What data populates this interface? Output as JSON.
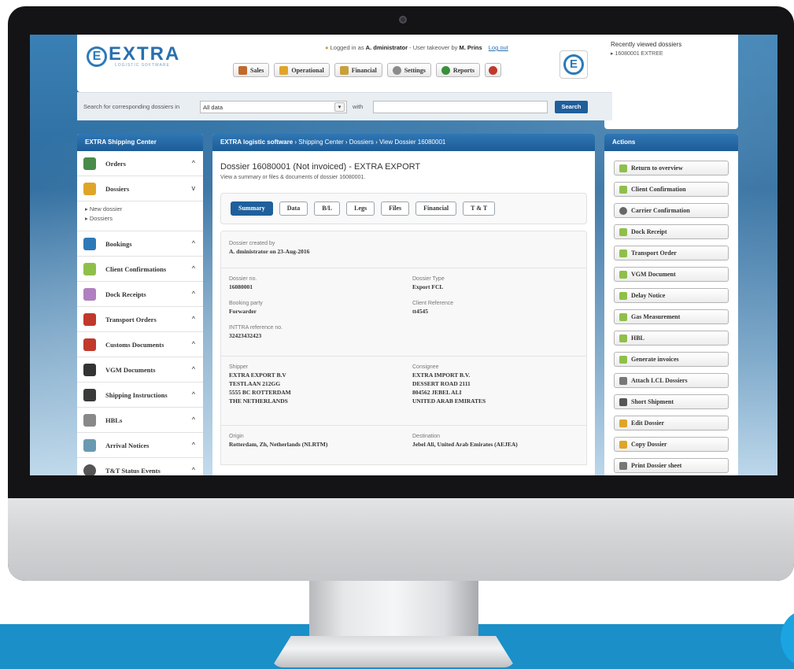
{
  "header": {
    "logo_text": "EXTRA",
    "logo_sub": "LOGISTIC SOFTWARE",
    "login_prefix": "Logged in as",
    "login_user": "A. dministrator",
    "login_mid": "- User takeover by",
    "takeover_user": "M. Prins",
    "logout": "Log out",
    "menu": [
      {
        "label": "Sales",
        "icon": "sales-icon",
        "color": "#c06a2b"
      },
      {
        "label": "Operational",
        "icon": "folder-icon",
        "color": "#e0a428"
      },
      {
        "label": "Financial",
        "icon": "coins-icon",
        "color": "#c9a03a"
      },
      {
        "label": "Settings",
        "icon": "gear-icon",
        "color": "#8b8b8b"
      },
      {
        "label": "Reports",
        "icon": "chart-icon",
        "color": "#3a8f3a"
      }
    ]
  },
  "recent": {
    "title": "Recently viewed dossiers",
    "item": "16080001   EXTREE"
  },
  "search": {
    "label": "Search for corresponding dossiers in",
    "select_value": "All data",
    "with_label": "with",
    "button": "Search"
  },
  "left": {
    "title": "EXTRA Shipping Center",
    "items": [
      {
        "label": "Orders",
        "chev": "^",
        "color": "#4a8a4a"
      },
      {
        "label": "Dossiers",
        "chev": "v",
        "color": "#e0a428"
      },
      {
        "label": "Bookings",
        "chev": "^",
        "color": "#2d79b8"
      },
      {
        "label": "Client Confirmations",
        "chev": "^",
        "color": "#8fbf4a"
      },
      {
        "label": "Dock Receipts",
        "chev": "^",
        "color": "#b080c0"
      },
      {
        "label": "Transport Orders",
        "chev": "^",
        "color": "#c0392b"
      },
      {
        "label": "Customs Documents",
        "chev": "^",
        "color": "#c0392b"
      },
      {
        "label": "VGM Documents",
        "chev": "^",
        "color": "#333333"
      },
      {
        "label": "Shipping Instructions",
        "chev": "^",
        "color": "#3a3a3a"
      },
      {
        "label": "HBLs",
        "chev": "^",
        "color": "#888888"
      },
      {
        "label": "Arrival Notices",
        "chev": "^",
        "color": "#6a9ab0"
      },
      {
        "label": "T&T Status Events",
        "chev": "^",
        "color": "#555555"
      }
    ],
    "sub": [
      "▸ New dossier",
      "▸ Dossiers"
    ]
  },
  "center": {
    "crumb": "EXTRA logistic software",
    "crumb_rest": " › Shipping Center › Dossiers › View Dossier 16080001",
    "title": "Dossier 16080001 (Not invoiced) - EXTRA EXPORT",
    "subtitle": "View a summary or files & documents of dossier 16080001.",
    "tabs": [
      "Summary",
      "Data",
      "B/L",
      "Legs",
      "Files",
      "Financial",
      "T & T"
    ],
    "created_label": "Dossier created by",
    "created_value": "A. dministrator on 23-Aug-2016",
    "dossier_no_label": "Dossier no.",
    "dossier_no": "16080001",
    "dossier_type_label": "Dossier Type",
    "dossier_type": "Export FCL",
    "booking_party_label": "Booking party",
    "booking_party": "Forwarder",
    "client_ref_label": "Client Reference",
    "client_ref": "tt4545",
    "inttra_label": "INTTRA reference no.",
    "inttra": "32423432423",
    "shipper_label": "Shipper",
    "shipper": [
      "EXTRA EXPORT B.V",
      "TESTLAAN 212GG",
      "5555 BC ROTTERDAM",
      "THE NETHERLANDS"
    ],
    "consignee_label": "Consignee",
    "consignee": [
      "EXTRA IMPORT B.V.",
      "DESSERT ROAD 2111",
      "804562 JEBEL ALI",
      "UNITED ARAB EMIRATES"
    ],
    "origin_label": "Origin",
    "origin": "Rotterdam, Zh, Netherlands (NLRTM)",
    "destination_label": "Destination",
    "destination": "Jebel Ali, United Arab Emirates (AEJEA)"
  },
  "actions": {
    "title": "Actions",
    "items": [
      {
        "label": "Return to overview",
        "color": "#8fbf4a"
      },
      {
        "label": "Client Confirmation",
        "color": "#8fbf4a"
      },
      {
        "label": "Carrier Confirmation",
        "color": "#666666"
      },
      {
        "label": "Dock Receipt",
        "color": "#8fbf4a"
      },
      {
        "label": "Transport Order",
        "color": "#8fbf4a"
      },
      {
        "label": "VGM Document",
        "color": "#8fbf4a"
      },
      {
        "label": "Delay Notice",
        "color": "#8fbf4a"
      },
      {
        "label": "Gas Measurement",
        "color": "#8fbf4a"
      },
      {
        "label": "HBL",
        "color": "#8fbf4a"
      },
      {
        "label": "Generate invoices",
        "color": "#8fbf4a"
      },
      {
        "label": "Attach LCL Dossiers",
        "color": "#777777"
      },
      {
        "label": "Short Shipment",
        "color": "#555555"
      },
      {
        "label": "Edit Dossier",
        "color": "#e0a428"
      },
      {
        "label": "Copy Dossier",
        "color": "#e0a428"
      },
      {
        "label": "Print Dossier sheet",
        "color": "#777777"
      }
    ]
  }
}
